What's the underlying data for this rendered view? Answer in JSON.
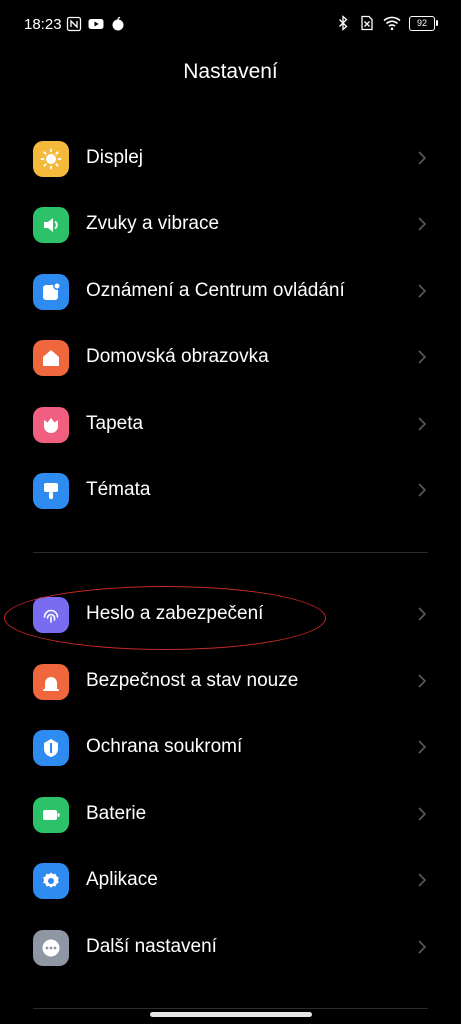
{
  "status": {
    "time": "18:23",
    "battery": "92",
    "left_icons": [
      "nfc-icon",
      "youtube-icon",
      "app-icon"
    ],
    "right_icons": [
      "bluetooth-icon",
      "no-sim-icon",
      "wifi-icon",
      "battery-icon"
    ]
  },
  "header": {
    "title": "Nastavení"
  },
  "settings": {
    "group1": [
      {
        "label": "Displej",
        "icon": "sun-icon",
        "color": "#F5B93B"
      },
      {
        "label": "Zvuky a vibrace",
        "icon": "speaker-icon",
        "color": "#2BC26A"
      },
      {
        "label": "Oznámení a Centrum ovládání",
        "icon": "notification-icon",
        "color": "#2E8BF0"
      },
      {
        "label": "Domovská obrazovka",
        "icon": "home-icon",
        "color": "#F0663D"
      },
      {
        "label": "Tapeta",
        "icon": "flower-icon",
        "color": "#F05E80"
      },
      {
        "label": "Témata",
        "icon": "brush-icon",
        "color": "#2E8BF0"
      }
    ],
    "group2": [
      {
        "label": "Heslo a zabezpečení",
        "icon": "fingerprint-icon",
        "color": "#7A6CF0"
      },
      {
        "label": "Bezpečnost a stav nouze",
        "icon": "emergency-icon",
        "color": "#F0663D"
      },
      {
        "label": "Ochrana soukromí",
        "icon": "privacy-icon",
        "color": "#2E8BF0"
      },
      {
        "label": "Baterie",
        "icon": "battery-icon",
        "color": "#2BC26A"
      },
      {
        "label": "Aplikace",
        "icon": "gear-icon",
        "color": "#2E8BF0"
      },
      {
        "label": "Další nastavení",
        "icon": "more-icon",
        "color": "#8E97A3"
      }
    ]
  },
  "annotation": {
    "highlight_color": "#C62828"
  }
}
